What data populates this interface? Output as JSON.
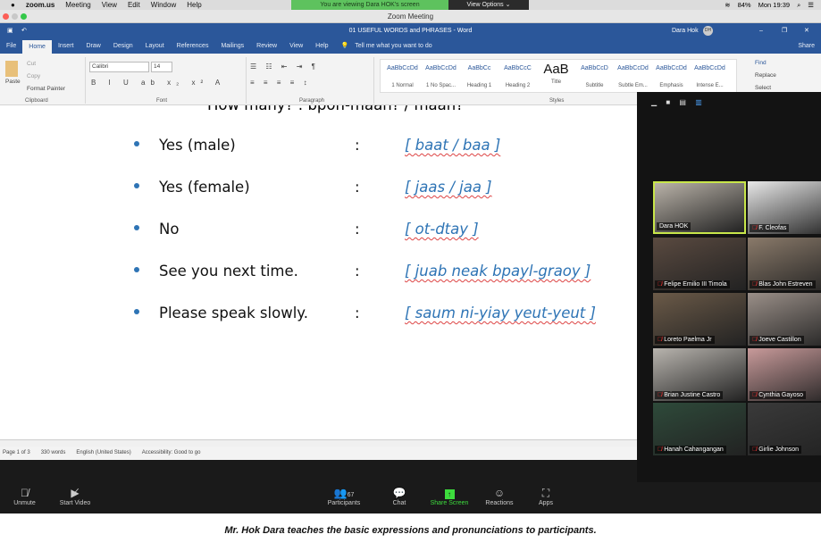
{
  "menubar": {
    "app": "zoom.us",
    "items": [
      "Meeting",
      "View",
      "Edit",
      "Window",
      "Help"
    ],
    "banner": "You are viewing Dara HOK's screen",
    "view_options": "View Options ⌄",
    "battery": "84%",
    "clock": "Mon 19:39"
  },
  "zoom_window": {
    "title": "Zoom Meeting"
  },
  "word": {
    "doc_title": "01 USEFUL WORDS and PHRASES  -  Word",
    "user": "Dara Hok",
    "user_initials": "DH",
    "tabs": [
      "File",
      "Home",
      "Insert",
      "Draw",
      "Design",
      "Layout",
      "References",
      "Mailings",
      "Review",
      "View",
      "Help"
    ],
    "tell_me": "Tell me what you want to do",
    "share": "Share",
    "ribbon": {
      "paste": "Paste",
      "cut": "Cut",
      "copy": "Copy",
      "format_painter": "Format Painter",
      "font": "Calibri",
      "size": "14",
      "find": "Find",
      "replace": "Replace",
      "select": "Select",
      "groups": [
        "Clipboard",
        "Font",
        "Paragraph",
        "Styles"
      ],
      "styles": [
        {
          "sample": "AaBbCcDd",
          "label": "1 Normal"
        },
        {
          "sample": "AaBbCcDd",
          "label": "1 No Spac..."
        },
        {
          "sample": "AaBbCc",
          "label": "Heading 1"
        },
        {
          "sample": "AaBbCcC",
          "label": "Heading 2"
        },
        {
          "sample": "AaB",
          "label": "Title"
        },
        {
          "sample": "AaBbCcD",
          "label": "Subtitle"
        },
        {
          "sample": "AaBbCcDd",
          "label": "Subtle Em..."
        },
        {
          "sample": "AaBbCcDd",
          "label": "Emphasis"
        },
        {
          "sample": "AaBbCcDd",
          "label": "Intense E..."
        }
      ]
    },
    "document": {
      "partial_top": "How many? : bpon-maan? / maan?",
      "rows": [
        {
          "en": "Yes (male)",
          "pr": "[ baat / baa ]"
        },
        {
          "en": "Yes (female)",
          "pr": "[ jaas / jaa ]"
        },
        {
          "en": "No",
          "pr": "[ ot-dtay ]"
        },
        {
          "en": "See you next time.",
          "pr": "[ juab  neak  bpayl-graoy ]"
        },
        {
          "en": "Please speak slowly.",
          "pr": "[ saum  ni-yiay  yeut-yeut ]"
        }
      ],
      "colon": ":"
    },
    "status": {
      "page": "Page 1 of 3",
      "words": "330 words",
      "language": "English (United States)",
      "accessibility": "Accessibility: Good to go"
    }
  },
  "participants_panel": {
    "tiles": [
      {
        "name": "Dara HOK",
        "muted": false,
        "active": true,
        "color": "#b9b2a8"
      },
      {
        "name": "F. Cleofas",
        "muted": true,
        "color": "#e8e8e8"
      },
      {
        "name": "Felipe Emilio III Timola",
        "muted": true,
        "color": "#5a4a40"
      },
      {
        "name": "Blas John Estreven",
        "muted": true,
        "color": "#8a7a6a"
      },
      {
        "name": "Loreto Paelma Jr",
        "muted": true,
        "color": "#6b5a48"
      },
      {
        "name": "Joeve Castillon",
        "muted": true,
        "color": "#9a8f88"
      },
      {
        "name": "Brian Justine Castro",
        "muted": true,
        "color": "#b8b4ae"
      },
      {
        "name": "Cynthia Gayoso",
        "muted": true,
        "color": "#c89a9a"
      },
      {
        "name": "Hanah Cahangangan",
        "muted": true,
        "color": "#2e4a3a"
      },
      {
        "name": "Girlie Johnson",
        "muted": true,
        "color": "#3a3a3a"
      }
    ]
  },
  "toolbar": {
    "unmute": "Unmute",
    "start_video": "Start Video",
    "participants": "Participants",
    "participant_count": "67",
    "chat": "Chat",
    "share_screen": "Share Screen",
    "reactions": "Reactions",
    "apps": "Apps",
    "share_color": "#3ddc3d"
  },
  "caption": "Mr. Hok Dara teaches the basic expressions and pronunciations to participants."
}
